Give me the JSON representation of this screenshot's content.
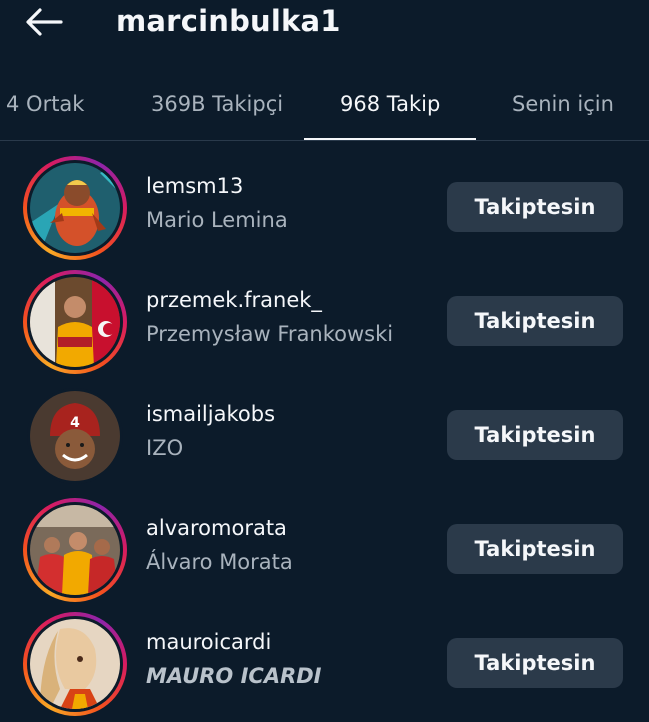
{
  "header": {
    "title": "marcinbulka1"
  },
  "tabs": [
    {
      "label": "4 Ortak"
    },
    {
      "label": "369B Takipçi"
    },
    {
      "label": "968 Takip"
    },
    {
      "label": "Senin için"
    }
  ],
  "active_tab": "968 Takip",
  "follow_list": [
    {
      "username": "lemsm13",
      "full_name": "Mario Lemina",
      "button": "Takiptesin",
      "has_story": true
    },
    {
      "username": "przemek.franek_",
      "full_name": "Przemysław Frankowski",
      "button": "Takiptesin",
      "has_story": true
    },
    {
      "username": "ismailjakobs",
      "full_name": "IZO",
      "button": "Takiptesin",
      "has_story": false
    },
    {
      "username": "alvaromorata",
      "full_name": "Álvaro Morata",
      "button": "Takiptesin",
      "has_story": true
    },
    {
      "username": "mauroicardi",
      "full_name": "MAURO ICARDI",
      "button": "Takiptesin",
      "has_story": true
    }
  ],
  "colors": {
    "background": "#0c1b2a",
    "button": "#2b3a4a",
    "secondary_text": "#a9b3bd"
  }
}
